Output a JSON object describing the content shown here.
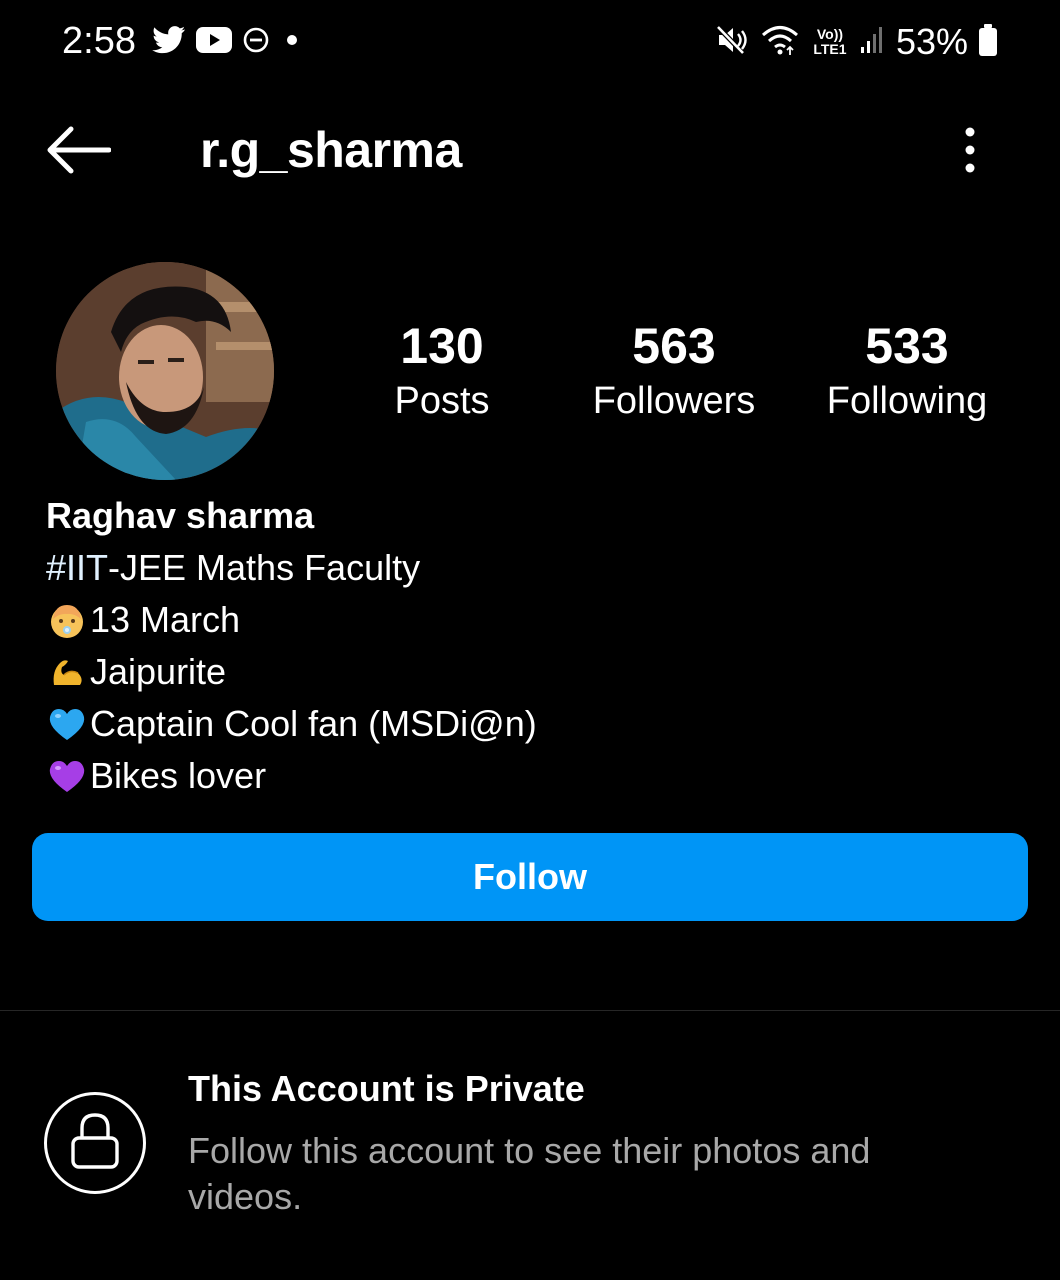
{
  "status_bar": {
    "time": "2:58",
    "left_icons": [
      "twitter-icon",
      "youtube-icon",
      "do-not-disturb-icon",
      "notification-dot-icon"
    ],
    "right_icons": [
      "mute-icon",
      "wifi-icon",
      "volte-lte-icon",
      "signal-icon",
      "battery-icon"
    ],
    "volte_label": "Vo))",
    "lte_label": "LTE1",
    "battery": "53%"
  },
  "header": {
    "username": "r.g_sharma",
    "back_icon": "back-arrow-icon",
    "more_icon": "more-vertical-icon"
  },
  "profile": {
    "stats": {
      "posts": {
        "value": "130",
        "label": "Posts"
      },
      "followers": {
        "value": "563",
        "label": "Followers"
      },
      "following": {
        "value": "533",
        "label": "Following"
      }
    },
    "name": "Raghav sharma",
    "bio": {
      "hashtag": "#IIT",
      "line1_rest": "-JEE Maths Faculty",
      "line2": "13 March",
      "line3": "Jaipurite",
      "line4": "Captain Cool fan (MSDi@n)",
      "line5": "Bikes lover"
    },
    "bio_icons": [
      "baby-emoji-icon",
      "flexed-biceps-emoji-icon",
      "blue-heart-emoji-icon",
      "purple-heart-emoji-icon"
    ]
  },
  "follow_button": {
    "label": "Follow",
    "color": "#0095f6"
  },
  "private_notice": {
    "title": "This Account is Private",
    "description": "Follow this account to see their photos and videos.",
    "icon": "lock-icon"
  }
}
